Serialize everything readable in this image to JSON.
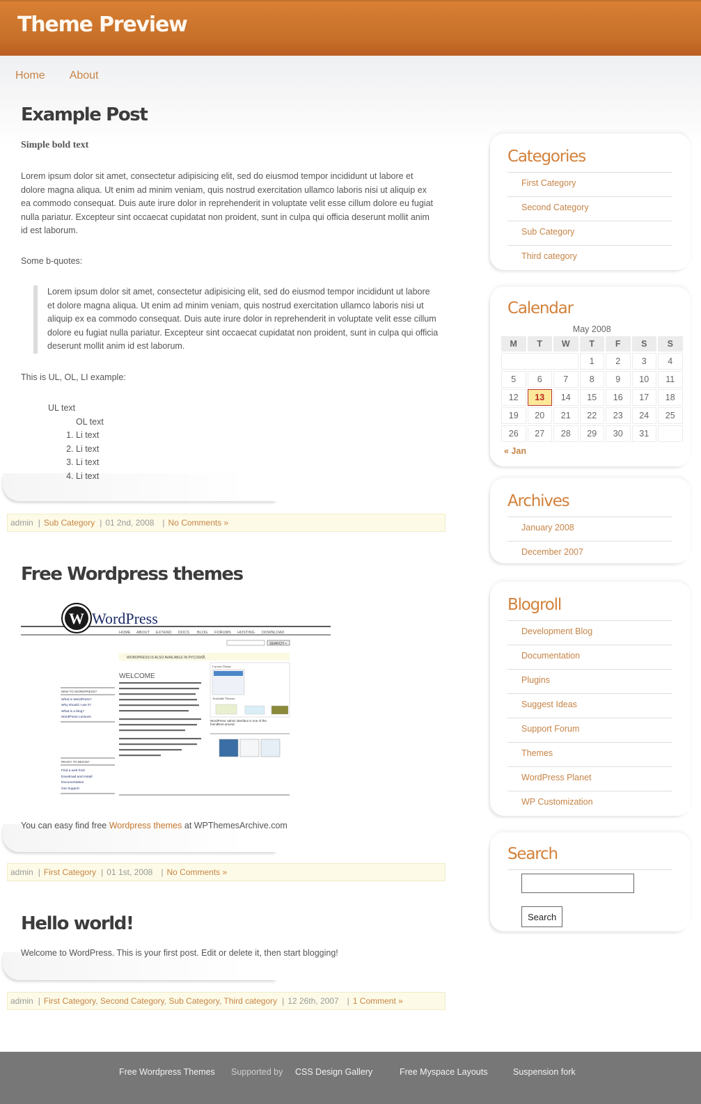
{
  "header": {
    "title": "Theme Preview"
  },
  "nav": {
    "items": [
      {
        "label": "Home"
      },
      {
        "label": "About"
      }
    ]
  },
  "posts": [
    {
      "title": "Example Post",
      "bold_text": "Simple bold text",
      "paragraph": "Lorem ipsum dolor sit amet, consectetur adipisicing elit, sed do eiusmod tempor incididunt ut labore et dolore magna aliqua. Ut enim ad minim veniam, quis nostrud exercitation ullamco laboris nisi ut aliquip ex ea commodo consequat. Duis aute irure dolor in reprehenderit in voluptate velit esse cillum dolore eu fugiat nulla pariatur. Excepteur sint occaecat cupidatat non proident, sunt in culpa qui officia deserunt mollit anim id est laborum.",
      "bquote_intro": "Some b-quotes:",
      "blockquote": "Lorem ipsum dolor sit amet, consectetur adipisicing elit, sed do eiusmod tempor incididunt ut labore et dolore magna aliqua. Ut enim ad minim veniam, quis nostrud exercitation ullamco laboris nisi ut aliquip ex ea commodo consequat. Duis aute irure dolor in reprehenderit in voluptate velit esse cillum dolore eu fugiat nulla pariatur. Excepteur sint occaecat cupidatat non proident, sunt in culpa qui officia deserunt mollit anim id est laborum.",
      "list_intro": "This is UL, OL, LI example:",
      "ul_text": "UL text",
      "ol_text": "OL text",
      "li_items": [
        "Li text",
        "Li text",
        "Li text",
        "Li text"
      ],
      "meta": {
        "author": "admin",
        "categories": [
          "Sub Category"
        ],
        "date": "01 2nd, 2008",
        "comments": "No Comments »"
      }
    },
    {
      "title": "Free Wordpress themes",
      "image": {
        "logo_text": "WordPress",
        "nav": [
          "HOME",
          "ABOUT",
          "EXTEND",
          "DOCS",
          "BLOG",
          "FORUMS",
          "HOSTING",
          "DOWNLOAD"
        ],
        "search_button": "SEARCH »",
        "notice": "WORDPRESS IS ALSO AVAILABLE IN РУССКИЙ.",
        "welcome": "WELCOME",
        "new_heading": "NEW TO WORDPRESS?",
        "new_links": [
          "What is WordPress?",
          "Why should I use it?",
          "What is a blog?",
          "WordPress Lessons"
        ],
        "ready_heading": "READY TO BEGIN?",
        "ready_links": [
          "Find a web host",
          "Download and Install",
          "Documentation",
          "Get Support"
        ],
        "current_theme": "Current Theme",
        "available_themes": "Available Themes",
        "caption": "WordPress' admin interface is one of the friendliest around."
      },
      "text_before": "You can easy find free ",
      "link": "Wordpress themes",
      "text_after": " at WPThemesArchive.com",
      "meta": {
        "author": "admin",
        "categories": [
          "First Category"
        ],
        "date": "01 1st, 2008",
        "comments": "No Comments »"
      }
    },
    {
      "title": "Hello world!",
      "paragraph": "Welcome to WordPress. This is your first post. Edit or delete it, then start blogging!",
      "meta": {
        "author": "admin",
        "categories": [
          "First Category",
          "Second Category",
          "Sub Category",
          "Third category"
        ],
        "date": "12 26th, 2007",
        "comments": "1 Comment »"
      }
    }
  ],
  "sidebar": {
    "categories": {
      "title": "Categories",
      "items": [
        "First Category",
        "Second Category",
        "Sub Category",
        "Third category"
      ]
    },
    "calendar": {
      "title": "Calendar",
      "caption": "May 2008",
      "weekdays": [
        "M",
        "T",
        "W",
        "T",
        "F",
        "S",
        "S"
      ],
      "weeks": [
        [
          "",
          "",
          "",
          "1",
          "2",
          "3",
          "4"
        ],
        [
          "5",
          "6",
          "7",
          "8",
          "9",
          "10",
          "11"
        ],
        [
          "12",
          "13",
          "14",
          "15",
          "16",
          "17",
          "18"
        ],
        [
          "19",
          "20",
          "21",
          "22",
          "23",
          "24",
          "25"
        ],
        [
          "26",
          "27",
          "28",
          "29",
          "30",
          "31",
          ""
        ]
      ],
      "today": "13",
      "prev_link": "« Jan"
    },
    "archives": {
      "title": "Archives",
      "items": [
        "January 2008",
        "December 2007"
      ]
    },
    "blogroll": {
      "title": "Blogroll",
      "items": [
        "Development Blog",
        "Documentation",
        "Plugins",
        "Suggest Ideas",
        "Support Forum",
        "Themes",
        "WordPress Planet",
        "WP Customization"
      ]
    },
    "search": {
      "title": "Search",
      "input_value": "",
      "button_label": "Search"
    }
  },
  "footer": {
    "links": [
      "Free Wordpress Themes",
      "CSS Design Gallery",
      "Free Myspace Layouts",
      "Suspension fork"
    ],
    "supported_by": "Supported by"
  },
  "colors": {
    "accent": "#c68446",
    "header": "#c8722b",
    "widget_title": "#d3813a",
    "meta_bg": "#fdfbe7",
    "footer_bg": "#777777"
  }
}
